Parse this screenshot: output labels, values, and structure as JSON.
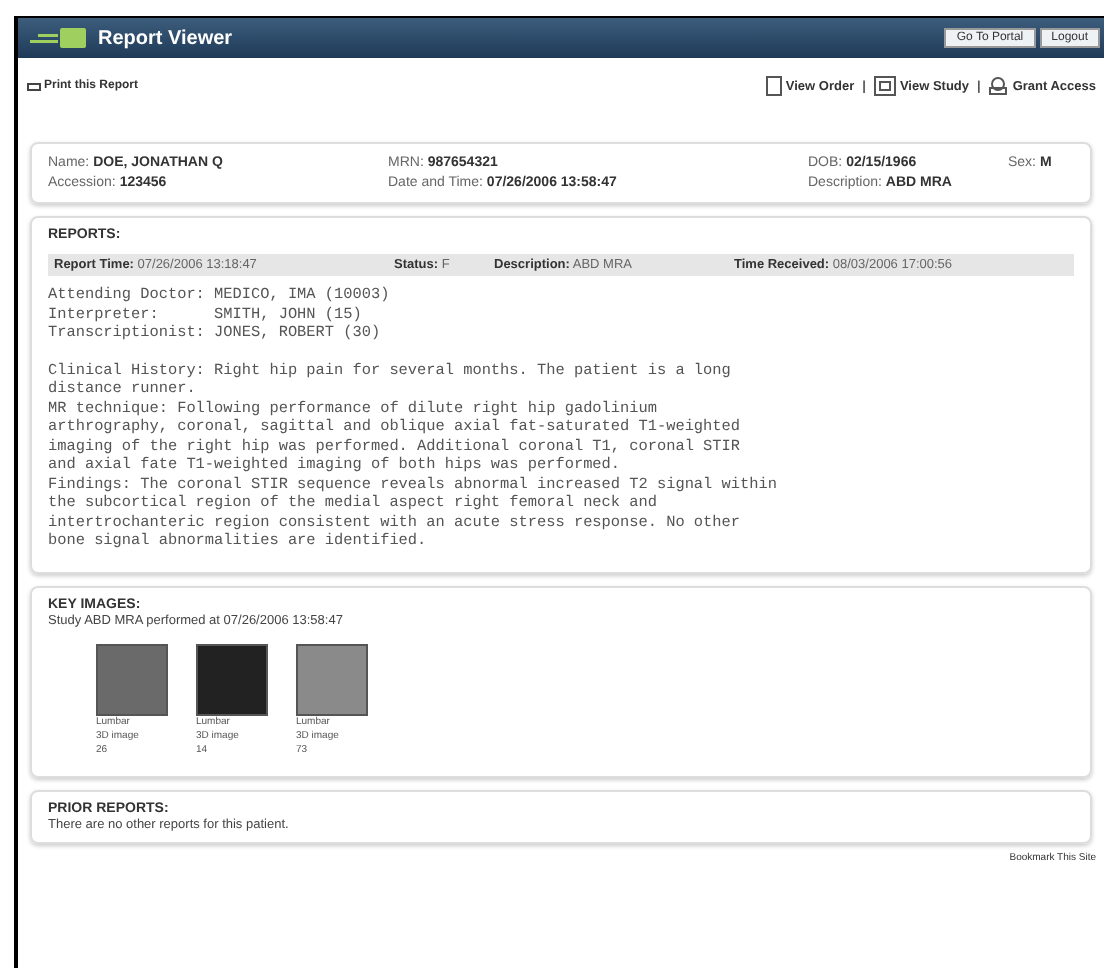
{
  "header": {
    "title": "Report Viewer",
    "buttons": [
      "Go To Portal",
      "Logout"
    ]
  },
  "toolbar": {
    "print": "Print this Report",
    "separator": "|",
    "actions": [
      {
        "kind": "order",
        "label": "View Order"
      },
      {
        "kind": "study",
        "label": "View Study"
      },
      {
        "kind": "access",
        "label": "Grant Access"
      }
    ]
  },
  "patient": {
    "fields": [
      {
        "label": "Name:",
        "value": "DOE, JONATHAN Q"
      },
      {
        "label": "MRN:",
        "value": "987654321"
      },
      {
        "label": "DOB:",
        "value": "02/15/1966"
      },
      {
        "label": "Sex:",
        "value": "M"
      },
      {
        "label": "Accession:",
        "value": "123456"
      },
      {
        "label": "Date and Time:",
        "value": "07/26/2006 13:58:47"
      },
      {
        "label": "Description:",
        "value": "ABD MRA"
      }
    ]
  },
  "reports": {
    "heading": "REPORTS:",
    "summary": [
      {
        "label": "Report Time:",
        "value": "07/26/2006 13:18:47"
      },
      {
        "label": "Status:",
        "value": "F"
      },
      {
        "label": "Description:",
        "value": "ABD MRA"
      },
      {
        "label": "Time Received:",
        "value": "08/03/2006 17:00:56"
      }
    ],
    "staff": [
      "Attending Doctor: MEDICO, IMA (10003)",
      "Interpreter:      SMITH, JOHN (15)",
      "Transcriptionist: JONES, ROBERT (30)"
    ],
    "body": [
      "Clinical History: Right hip pain for several months. The patient is a long",
      "distance runner.",
      "MR technique: Following performance of dilute right hip gadolinium",
      "arthrography, coronal, sagittal and oblique axial fat-saturated T1-weighted",
      "imaging of the right hip was performed. Additional coronal T1, coronal STIR",
      "and axial fate T1-weighted imaging of both hips was performed.",
      "Findings: The coronal STIR sequence reveals abnormal increased T2 signal within",
      "the subcortical region of the medial aspect right femoral neck and",
      "intertrochanteric region consistent with an acute stress response. No other",
      "bone signal abnormalities are identified."
    ]
  },
  "key_images": {
    "heading": "KEY IMAGES:",
    "subtitle": "Study ABD MRA performed at 07/26/2006 13:58:47",
    "images": [
      {
        "lines": [
          "Lumbar",
          "3D image",
          "26"
        ]
      },
      {
        "lines": [
          "Lumbar",
          "3D image",
          "14"
        ]
      },
      {
        "lines": [
          "Lumbar",
          "3D image",
          "73"
        ]
      }
    ]
  },
  "prior_reports": {
    "heading": "PRIOR REPORTS:",
    "message": "There are no other reports for this patient."
  },
  "footer": "Bookmark This Site"
}
